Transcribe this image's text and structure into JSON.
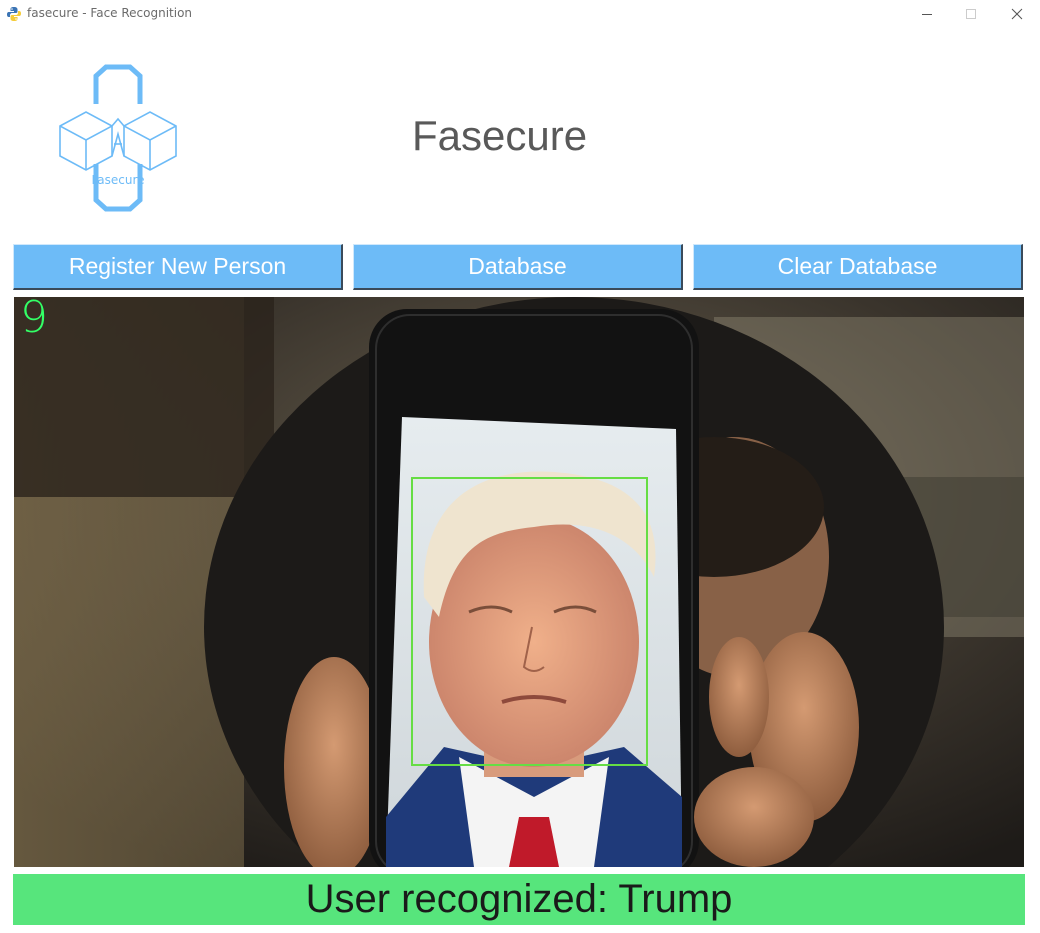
{
  "window": {
    "title": "fasecure - Face Recognition",
    "icon": "python-icon",
    "controls": [
      "minimize-icon",
      "maximize-icon",
      "close-icon"
    ]
  },
  "header": {
    "logo_text": "Fasecure",
    "title": "Fasecure"
  },
  "toolbar": {
    "register_label": "Register New Person",
    "database_label": "Database",
    "clear_label": "Clear Database"
  },
  "camera": {
    "frame_counter": "9",
    "face_box_color": "#66dd44"
  },
  "status": {
    "message": "User recognized: Trump",
    "color": "#57e57c"
  },
  "colors": {
    "button": "#6dbbf7",
    "logo": "#6dbbf7",
    "counter": "#33ff66"
  }
}
